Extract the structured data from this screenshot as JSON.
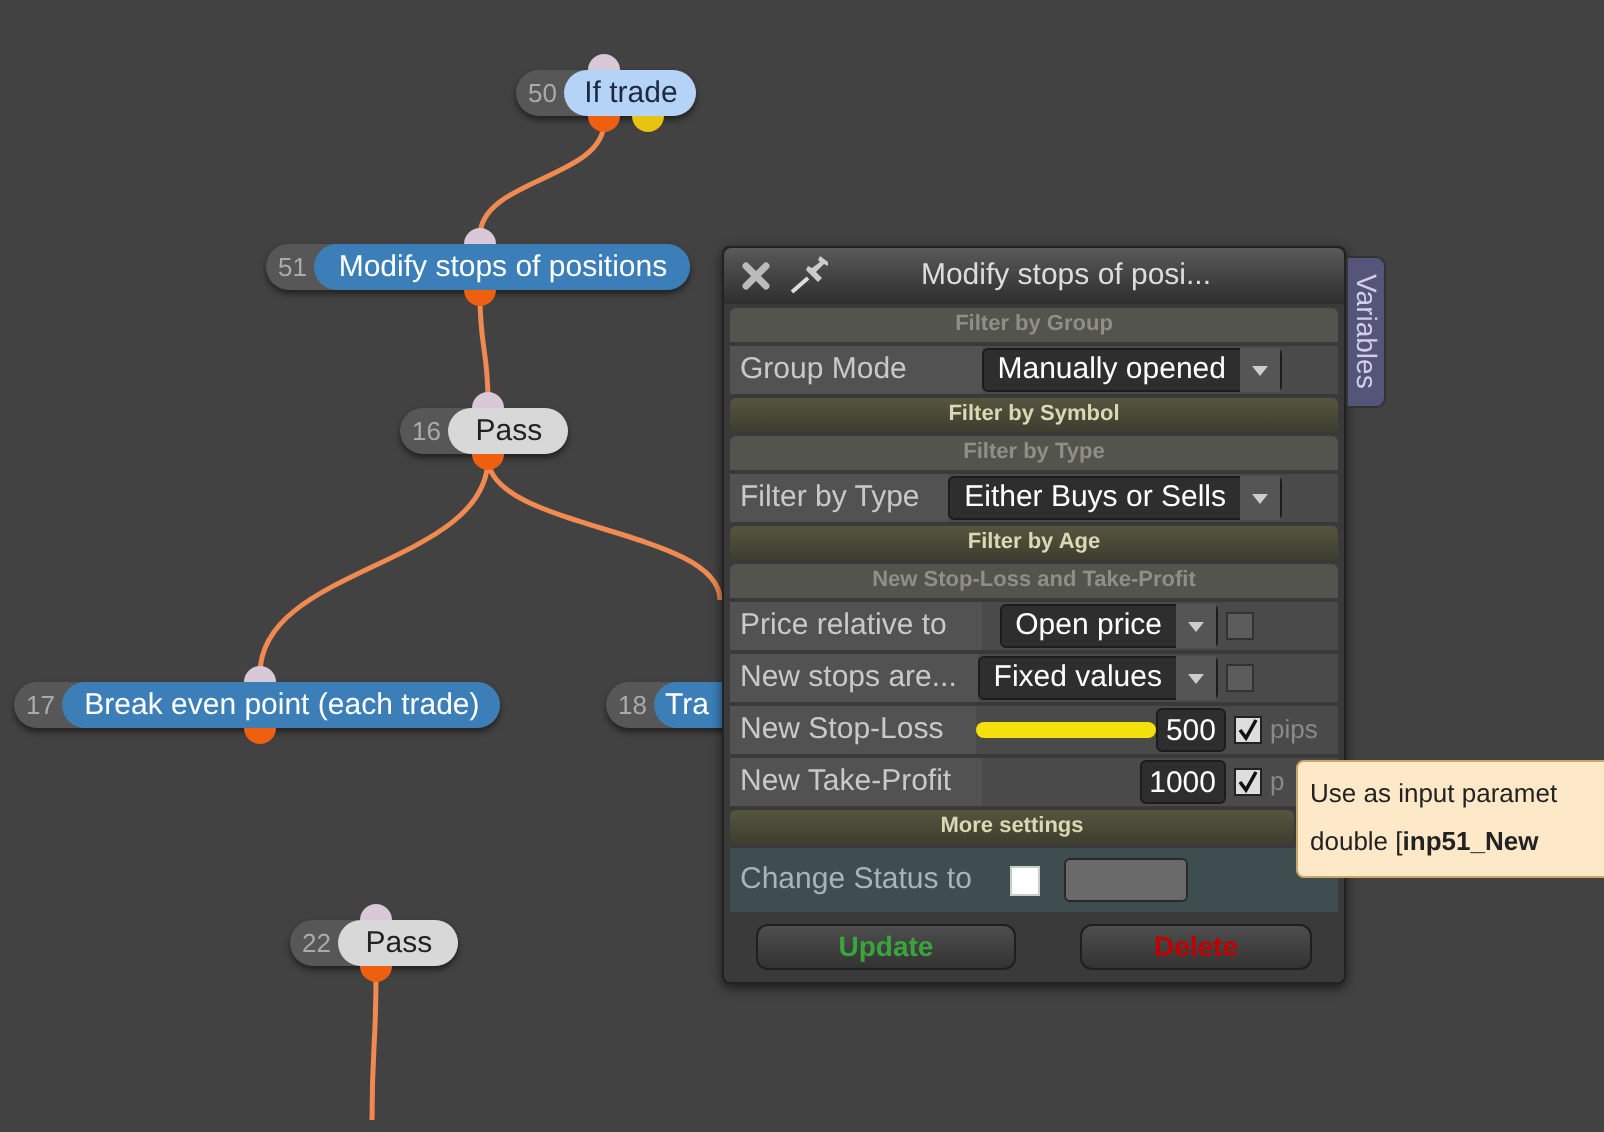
{
  "nodes": [
    {
      "number": "50",
      "label": "If trade",
      "kind": "condition"
    },
    {
      "number": "51",
      "label": "Modify stops of positions",
      "kind": "action"
    },
    {
      "number": "16",
      "label": "Pass",
      "kind": "pass"
    },
    {
      "number": "17",
      "label": "Break even point (each trade)",
      "kind": "action"
    },
    {
      "number": "18",
      "label": "Tra",
      "kind": "action"
    },
    {
      "number": "22",
      "label": "Pass",
      "kind": "pass"
    }
  ],
  "dialog": {
    "title": "Modify stops of posi...",
    "side_tab": "Variables",
    "sections": [
      {
        "kind": "header",
        "title": "Filter by Group",
        "expanded": true
      },
      {
        "kind": "select",
        "label": "Group Mode",
        "value": "Manually opened"
      },
      {
        "kind": "header",
        "title": "Filter by Symbol",
        "expanded": false
      },
      {
        "kind": "header",
        "title": "Filter by Type",
        "expanded": true
      },
      {
        "kind": "select",
        "label": "Filter by Type",
        "value": "Either Buys or Sells"
      },
      {
        "kind": "header",
        "title": "Filter by Age",
        "expanded": false
      },
      {
        "kind": "header",
        "title": "New Stop-Loss and Take-Profit",
        "expanded": true
      },
      {
        "kind": "select",
        "label": "Price relative to",
        "value": "Open price",
        "checked": false
      },
      {
        "kind": "select",
        "label": "New stops are...",
        "value": "Fixed values",
        "checked": false
      },
      {
        "kind": "number",
        "label": "New Stop-Loss",
        "value": "500",
        "checked": true,
        "unit": "pips"
      },
      {
        "kind": "number",
        "label": "New Take-Profit",
        "value": "1000",
        "checked": true,
        "unit": "p"
      },
      {
        "kind": "header",
        "title": "More settings",
        "expanded": false
      },
      {
        "kind": "status",
        "label": "Change Status to",
        "checked": false
      }
    ],
    "buttons": [
      {
        "label": "Update",
        "kind": "update"
      },
      {
        "label": "Delete",
        "kind": "delete"
      }
    ]
  },
  "tooltip": {
    "lines": [
      "Use as input paramet",
      "double [**inp51_New**"
    ]
  }
}
